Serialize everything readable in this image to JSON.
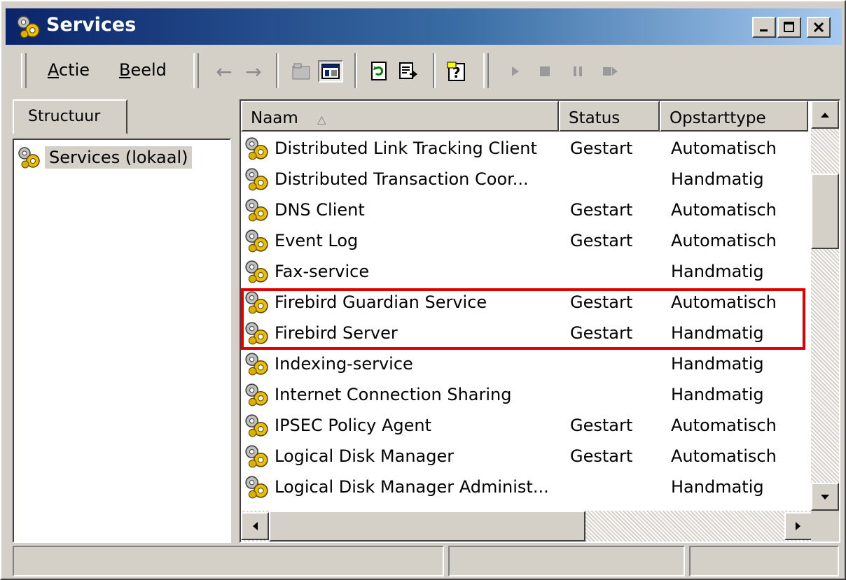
{
  "window": {
    "title": "Services",
    "icon": "services-gears-icon",
    "controls": [
      "minimize-icon",
      "maximize-icon",
      "close-icon"
    ]
  },
  "menu": [
    {
      "label": "Actie",
      "mnemonic": "A",
      "rest": "ctie"
    },
    {
      "label": "Beeld",
      "mnemonic": "B",
      "rest": "eeld"
    }
  ],
  "toolbar": {
    "back": "←",
    "forward": "→",
    "buttons": [
      "up-folder-icon",
      "show-hide-tree-icon",
      "refresh-icon",
      "export-list-icon",
      "help-icon",
      "start-service-icon",
      "stop-service-icon",
      "pause-service-icon",
      "restart-service-icon"
    ]
  },
  "tree": {
    "tab_label": "Structuur",
    "root_label": "Services (lokaal)"
  },
  "list": {
    "columns": {
      "name": "Naam",
      "status": "Status",
      "startup": "Opstarttype"
    },
    "sort_indicator": "△",
    "rows": [
      {
        "name": "Distributed Link Tracking Client",
        "status": "Gestart",
        "startup": "Automatisch"
      },
      {
        "name": "Distributed Transaction Coor...",
        "status": "",
        "startup": "Handmatig"
      },
      {
        "name": "DNS Client",
        "status": "Gestart",
        "startup": "Automatisch"
      },
      {
        "name": "Event Log",
        "status": "Gestart",
        "startup": "Automatisch"
      },
      {
        "name": "Fax-service",
        "status": "",
        "startup": "Handmatig"
      },
      {
        "name": "Firebird Guardian Service",
        "status": "Gestart",
        "startup": "Automatisch"
      },
      {
        "name": "Firebird Server",
        "status": "Gestart",
        "startup": "Handmatig"
      },
      {
        "name": "Indexing-service",
        "status": "",
        "startup": "Handmatig"
      },
      {
        "name": "Internet Connection Sharing",
        "status": "",
        "startup": "Handmatig"
      },
      {
        "name": "IPSEC Policy Agent",
        "status": "Gestart",
        "startup": "Automatisch"
      },
      {
        "name": "Logical Disk Manager",
        "status": "Gestart",
        "startup": "Automatisch"
      },
      {
        "name": "Logical Disk Manager Administ...",
        "status": "",
        "startup": "Handmatig"
      }
    ],
    "highlight_color": "#e00000"
  },
  "colors": {
    "titlebar_start": "#0a246a",
    "titlebar_end": "#a6caf0",
    "face": "#d4d0c8"
  }
}
